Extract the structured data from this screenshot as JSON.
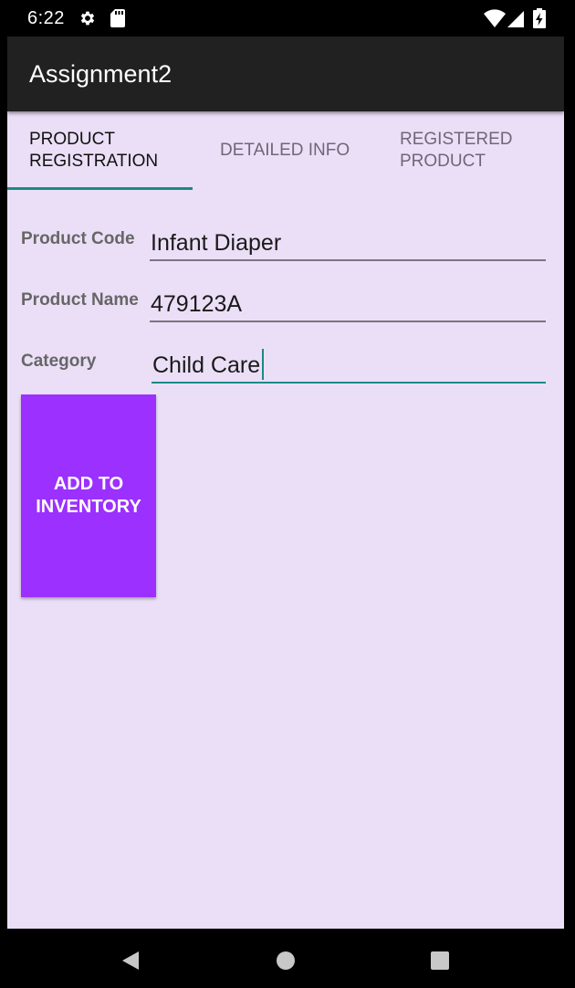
{
  "status_bar": {
    "time": "6:22",
    "left_icons": [
      "gear-icon",
      "sd-card-icon"
    ],
    "right_icons": [
      "wifi-icon",
      "signal-icon",
      "battery-charging-icon"
    ]
  },
  "app_bar": {
    "title": "Assignment2",
    "background": "#212121"
  },
  "tabs": [
    {
      "label_line1": "PRODUCT",
      "label_line2": "REGISTRATION",
      "active": true
    },
    {
      "label_line1": "DETAILED INFO",
      "label_line2": "",
      "active": false
    },
    {
      "label_line1": "REGISTERED",
      "label_line2": "PRODUCT",
      "active": false
    }
  ],
  "form": {
    "fields": [
      {
        "label": "Product Code",
        "value": "Infant Diaper"
      },
      {
        "label": "Product Name",
        "value": "479123A"
      },
      {
        "label": "Category",
        "value": "Child Care",
        "focused": true
      }
    ],
    "submit_label": "ADD TO INVENTORY"
  },
  "colors": {
    "background": "#ebdff7",
    "accent": "#1b8a86",
    "button": "#9b30ff"
  },
  "nav_bar": {
    "icons": [
      "back-icon",
      "home-icon",
      "recents-icon"
    ]
  }
}
